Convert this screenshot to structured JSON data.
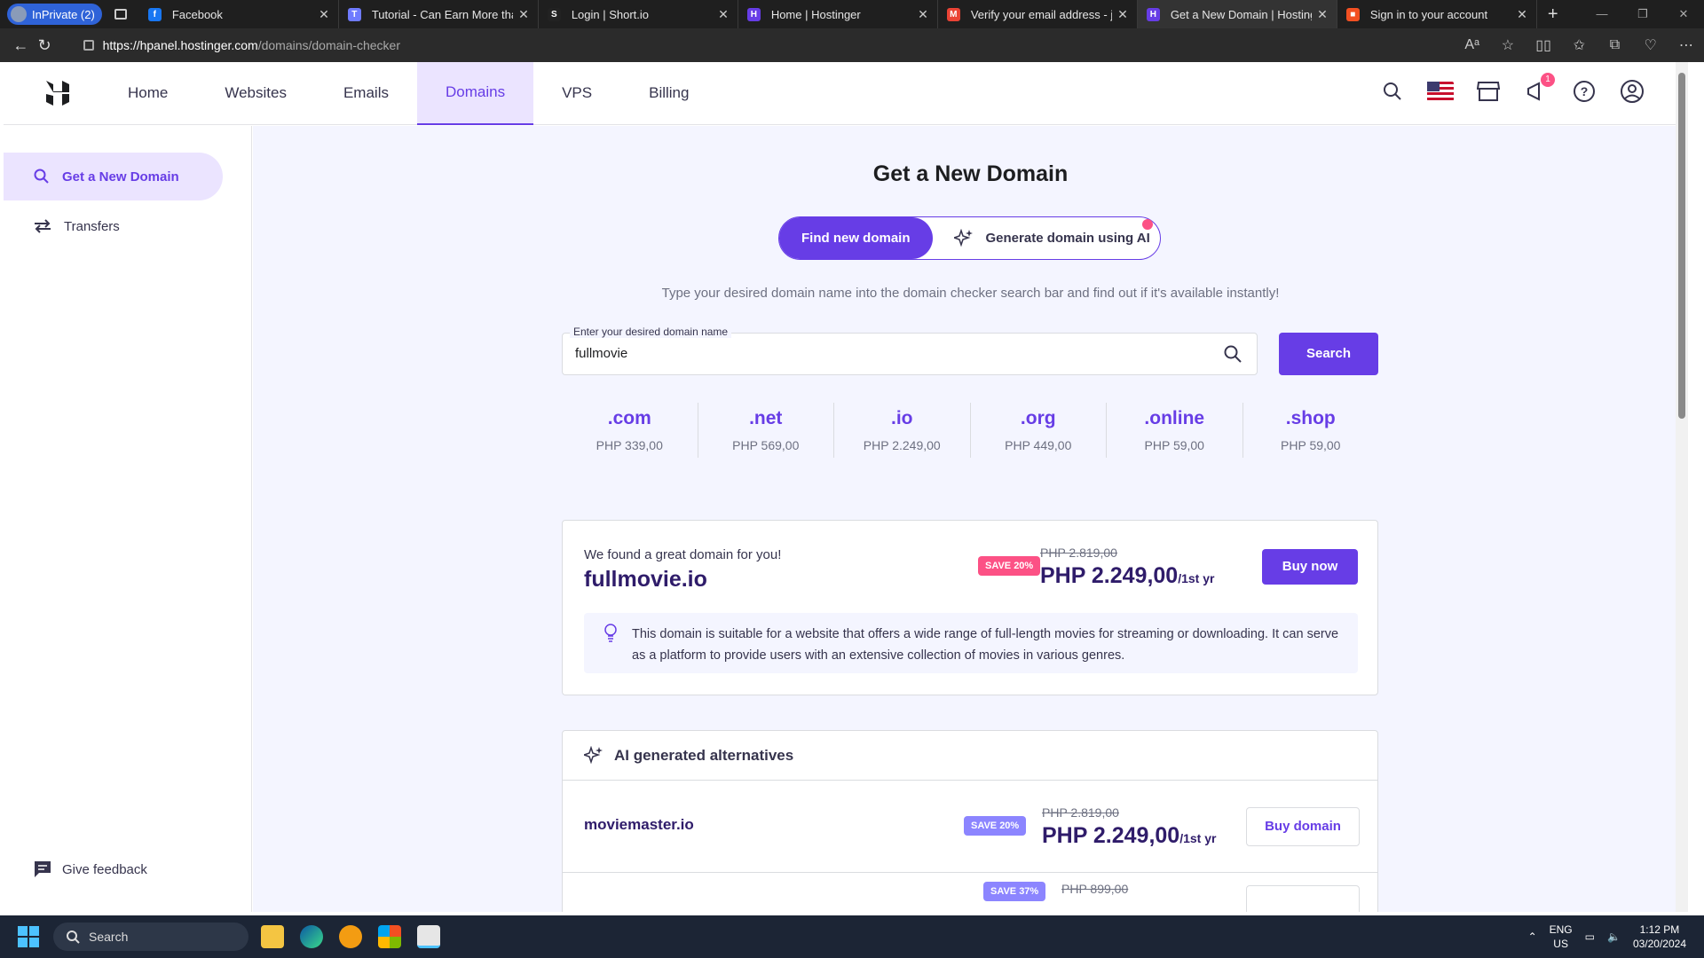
{
  "browser": {
    "profile_label": "InPrivate (2)",
    "tabs": [
      {
        "title": "Facebook",
        "color": "#1877f2",
        "glyph": "f"
      },
      {
        "title": "Tutorial - Can Earn More than",
        "color": "#6f7bff",
        "glyph": "T"
      },
      {
        "title": "Login | Short.io",
        "color": "#222222",
        "glyph": "S"
      },
      {
        "title": "Home | Hostinger",
        "color": "#673de6",
        "glyph": "H"
      },
      {
        "title": "Verify your email address - je",
        "color": "#ea4335",
        "glyph": "M"
      },
      {
        "title": "Get a New Domain | Hostinger",
        "color": "#673de6",
        "glyph": "H"
      },
      {
        "title": "Sign in to your account",
        "color": "#f25022",
        "glyph": "■"
      }
    ],
    "active_tab": 5,
    "url_host": "https://hpanel.hostinger.com",
    "url_path": "/domains/domain-checker"
  },
  "nav": {
    "items": [
      "Home",
      "Websites",
      "Emails",
      "Domains",
      "VPS",
      "Billing"
    ],
    "active": "Domains",
    "notification_count": "1"
  },
  "sidebar": {
    "items": [
      "Get a New Domain",
      "Transfers"
    ],
    "feedback": "Give feedback"
  },
  "main": {
    "title": "Get a New Domain",
    "toggle_find": "Find new domain",
    "toggle_ai": "Generate domain using AI",
    "subtitle": "Type your desired domain name into the domain checker search bar and find out if it's available instantly!",
    "search_label": "Enter your desired domain name",
    "search_value": "fullmovie",
    "search_button": "Search",
    "tlds": [
      {
        "name": ".com",
        "price": "PHP 339,00"
      },
      {
        "name": ".net",
        "price": "PHP 569,00"
      },
      {
        "name": ".io",
        "price": "PHP 2.249,00"
      },
      {
        "name": ".org",
        "price": "PHP 449,00"
      },
      {
        "name": ".online",
        "price": "PHP 59,00"
      },
      {
        "name": ".shop",
        "price": "PHP 59,00"
      }
    ],
    "featured": {
      "found_text": "We found a great domain for you!",
      "domain": "fullmovie.io",
      "save": "SAVE 20%",
      "old_price": "PHP 2.819,00",
      "price": "PHP 2.249,00",
      "period": "/1st yr",
      "buy": "Buy now",
      "description": "This domain is suitable for a website that offers a wide range of full-length movies for streaming or downloading. It can serve as a platform to provide users with an extensive collection of movies in various genres."
    },
    "alternatives": {
      "heading": "AI generated alternatives",
      "rows": [
        {
          "domain": "moviemaster.io",
          "save": "SAVE 20%",
          "old_price": "PHP 2.819,00",
          "price": "PHP 2.249,00",
          "period": "/1st yr",
          "buy": "Buy domain"
        },
        {
          "domain": "",
          "save": "SAVE 37%",
          "old_price": "PHP 899,00",
          "price": "",
          "period": "",
          "buy": ""
        }
      ]
    }
  },
  "taskbar": {
    "search": "Search",
    "lang": "ENG",
    "region": "US",
    "time": "1:12 PM",
    "date": "03/20/2024"
  },
  "colors": {
    "accent": "#673de6",
    "save_pink": "#fc5185"
  }
}
